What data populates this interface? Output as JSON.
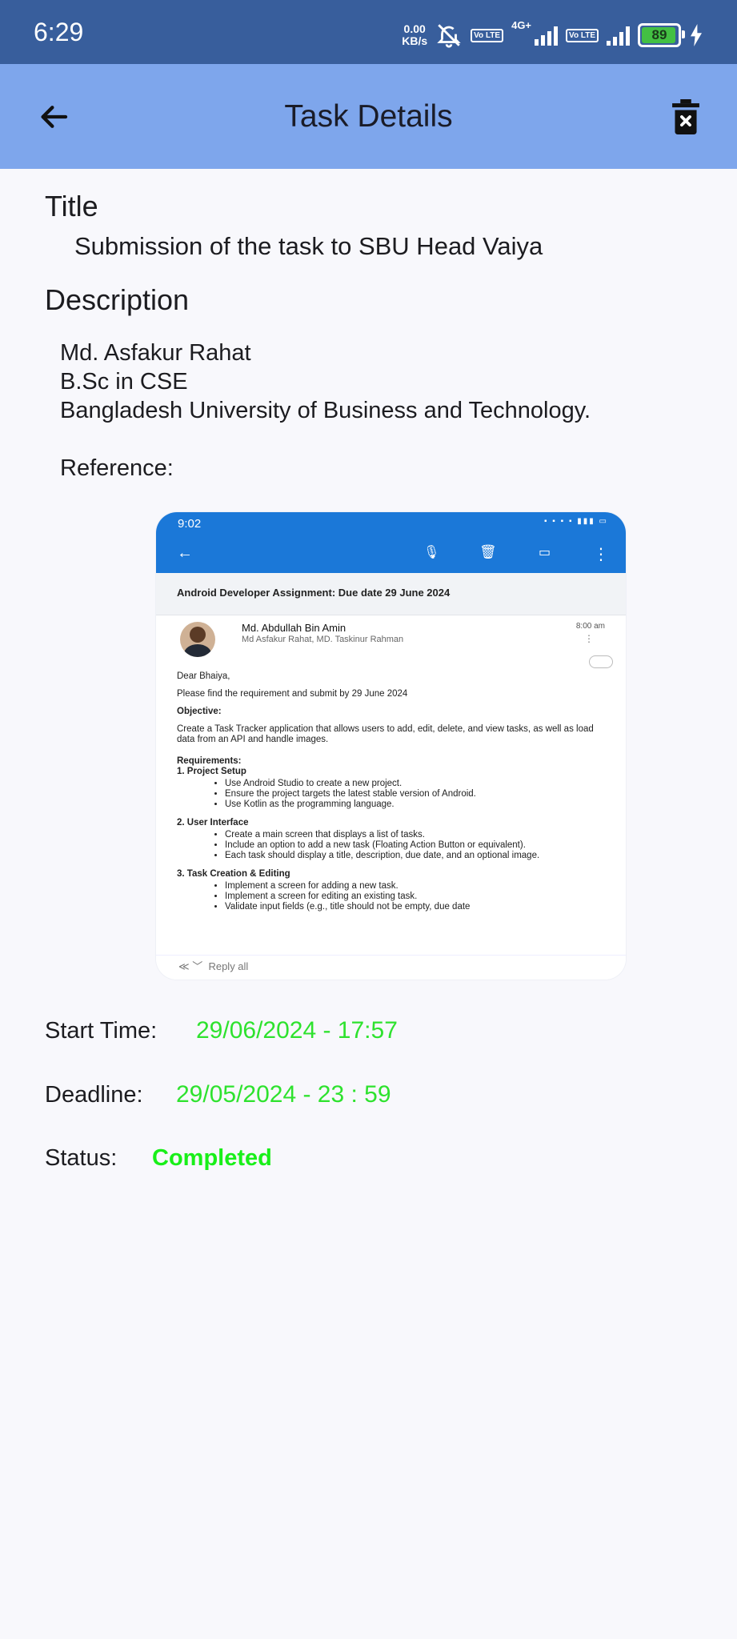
{
  "status_bar": {
    "time": "6:29",
    "net_speed_value": "0.00",
    "net_speed_unit": "KB/s",
    "sim1_label": "Vo LTE",
    "sim1_network": "4G+",
    "sim2_label": "Vo LTE",
    "battery_level": "89",
    "battery_color": "#43c043"
  },
  "app_bar": {
    "title": "Task Details",
    "back_icon": "arrow-left-icon",
    "delete_icon": "trash-delete-icon",
    "background": "#7ea6ec"
  },
  "task": {
    "title_label": "Title",
    "title_value": "Submission of the task to SBU Head Vaiya",
    "description_label": "Description",
    "description_lines": [
      "Md. Asfakur Rahat",
      "B.Sc in CSE",
      "Bangladesh University of Business and Technology.",
      "",
      "Reference:"
    ],
    "start_time_label": "Start Time:",
    "start_time_value": "29/06/2024 - 17:57",
    "deadline_label": "Deadline:",
    "deadline_value": "29/05/2024 - 23 : 59",
    "status_label": "Status:",
    "status_value": "Completed",
    "value_color": "#2ee22e"
  },
  "reference_image": {
    "status_time": "9:02",
    "subject": "Android Developer Assignment: Due date 29 June 2024",
    "sender_name": "Md. Abdullah Bin Amin",
    "recipients": "Md Asfakur Rahat, MD. Taskinur Rahman",
    "sent_time": "8:00 am",
    "greeting": "Dear Bhaiya,",
    "intro": "Please find the requirement and submit by 29 June 2024",
    "objective_heading": "Objective:",
    "objective_text": "Create a Task Tracker application that allows users to add, edit, delete, and view tasks, as well as load data from an API and handle images.",
    "requirements_heading": "Requirements:",
    "section1_heading": "1. Project Setup",
    "section1_items": [
      "Use Android Studio to create a new project.",
      "Ensure the project targets the latest stable version of Android.",
      "Use Kotlin as the programming language."
    ],
    "section2_heading": "2. User Interface",
    "section2_items": [
      "Create a main screen that displays a list of tasks.",
      "Include an option to add a new task (Floating Action Button or equivalent).",
      "Each task should display a title, description, due date, and an optional image."
    ],
    "section3_heading": "3. Task Creation & Editing",
    "section3_items": [
      "Implement a screen for adding a new task.",
      "Implement a screen for editing an existing task.",
      "Validate input fields (e.g., title should not be empty, due date"
    ],
    "reply_all": "Reply all"
  }
}
